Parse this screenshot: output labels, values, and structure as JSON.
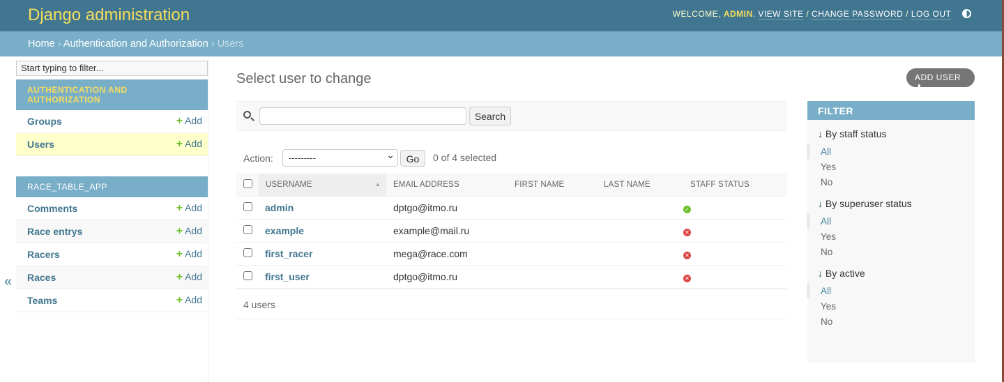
{
  "header": {
    "title": "Django administration",
    "welcome": "Welcome,",
    "user": "admin",
    "view_site": "View site",
    "change_password": "Change password",
    "log_out": "Log out"
  },
  "breadcrumbs": {
    "home": "Home",
    "app": "Authentication and Authorization",
    "current": "Users",
    "sep": "›"
  },
  "sidebar": {
    "filter_placeholder": "Start typing to filter...",
    "add_label": "Add",
    "modules": [
      {
        "caption": "Authentication and Authorization",
        "items": [
          {
            "label": "Groups"
          },
          {
            "label": "Users",
            "selected": true
          }
        ]
      },
      {
        "caption": "race_table_app",
        "items": [
          {
            "label": "Comments"
          },
          {
            "label": "Race entrys"
          },
          {
            "label": "Racers"
          },
          {
            "label": "Races"
          },
          {
            "label": "Teams"
          }
        ]
      }
    ]
  },
  "main": {
    "title": "Select user to change",
    "add_button": "Add user",
    "search_button": "Search",
    "search_value": "",
    "action_label": "Action:",
    "action_selected": "---------",
    "go_button": "Go",
    "counter": "0 of 4 selected",
    "columns": [
      "Username",
      "Email address",
      "First name",
      "Last name",
      "Staff status"
    ],
    "rows": [
      {
        "username": "admin",
        "email": "dptgo@itmo.ru",
        "first": "",
        "last": "",
        "staff": true
      },
      {
        "username": "example",
        "email": "example@mail.ru",
        "first": "",
        "last": "",
        "staff": false
      },
      {
        "username": "first_racer",
        "email": "mega@race.com",
        "first": "",
        "last": "",
        "staff": false
      },
      {
        "username": "first_user",
        "email": "dptgo@itmo.ru",
        "first": "",
        "last": "",
        "staff": false
      }
    ],
    "paginator": "4 users"
  },
  "filter": {
    "title": "Filter",
    "groups": [
      {
        "title": "By staff status",
        "options": [
          "All",
          "Yes",
          "No"
        ]
      },
      {
        "title": "By superuser status",
        "options": [
          "All",
          "Yes",
          "No"
        ]
      },
      {
        "title": "By active",
        "options": [
          "All",
          "Yes",
          "No"
        ]
      }
    ]
  },
  "colors": {
    "header": "#417690",
    "breadcrumb": "#79aec8",
    "accent": "#f5dd5d",
    "link": "#417690",
    "yes": "#70bf2b",
    "no": "#dd4646"
  }
}
